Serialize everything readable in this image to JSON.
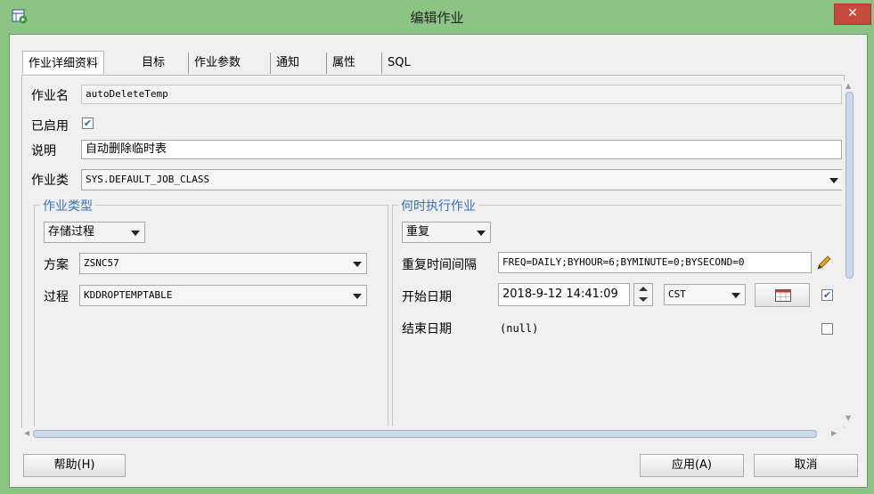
{
  "window": {
    "title": "编辑作业",
    "close_label": "✕"
  },
  "tabs": [
    {
      "label": "作业详细资料",
      "active": true
    },
    {
      "label": "目标"
    },
    {
      "label": "作业参数"
    },
    {
      "label": "通知"
    },
    {
      "label": "属性"
    },
    {
      "label": "SQL"
    }
  ],
  "details": {
    "job_name_label": "作业名",
    "job_name_value": "autoDeleteTemp",
    "enabled_label": "已启用",
    "enabled_checked": true,
    "description_label": "说明",
    "description_value": "自动删除临时表",
    "job_class_label": "作业类",
    "job_class_value": "SYS.DEFAULT_JOB_CLASS"
  },
  "job_type": {
    "group_title": "作业类型",
    "type_value": "存储过程",
    "schema_label": "方案",
    "schema_value": "ZSNC57",
    "procedure_label": "过程",
    "procedure_value": "KDDROPTEMPTABLE"
  },
  "schedule": {
    "group_title": "何时执行作业",
    "mode_value": "重复",
    "interval_label": "重复时间间隔",
    "interval_value": "FREQ=DAILY;BYHOUR=6;BYMINUTE=0;BYSECOND=0",
    "start_label": "开始日期",
    "start_value": "2018-9-12 14:41:09",
    "timezone_value": "CST",
    "start_checked": true,
    "end_label": "结束日期",
    "end_value": "(null)",
    "end_checked": false
  },
  "buttons": {
    "help": "帮助(H)",
    "apply": "应用(A)",
    "cancel": "取消"
  },
  "colors": {
    "frame": "#8cc485",
    "close": "#c74a3f",
    "group_title": "#3b6fb5"
  }
}
